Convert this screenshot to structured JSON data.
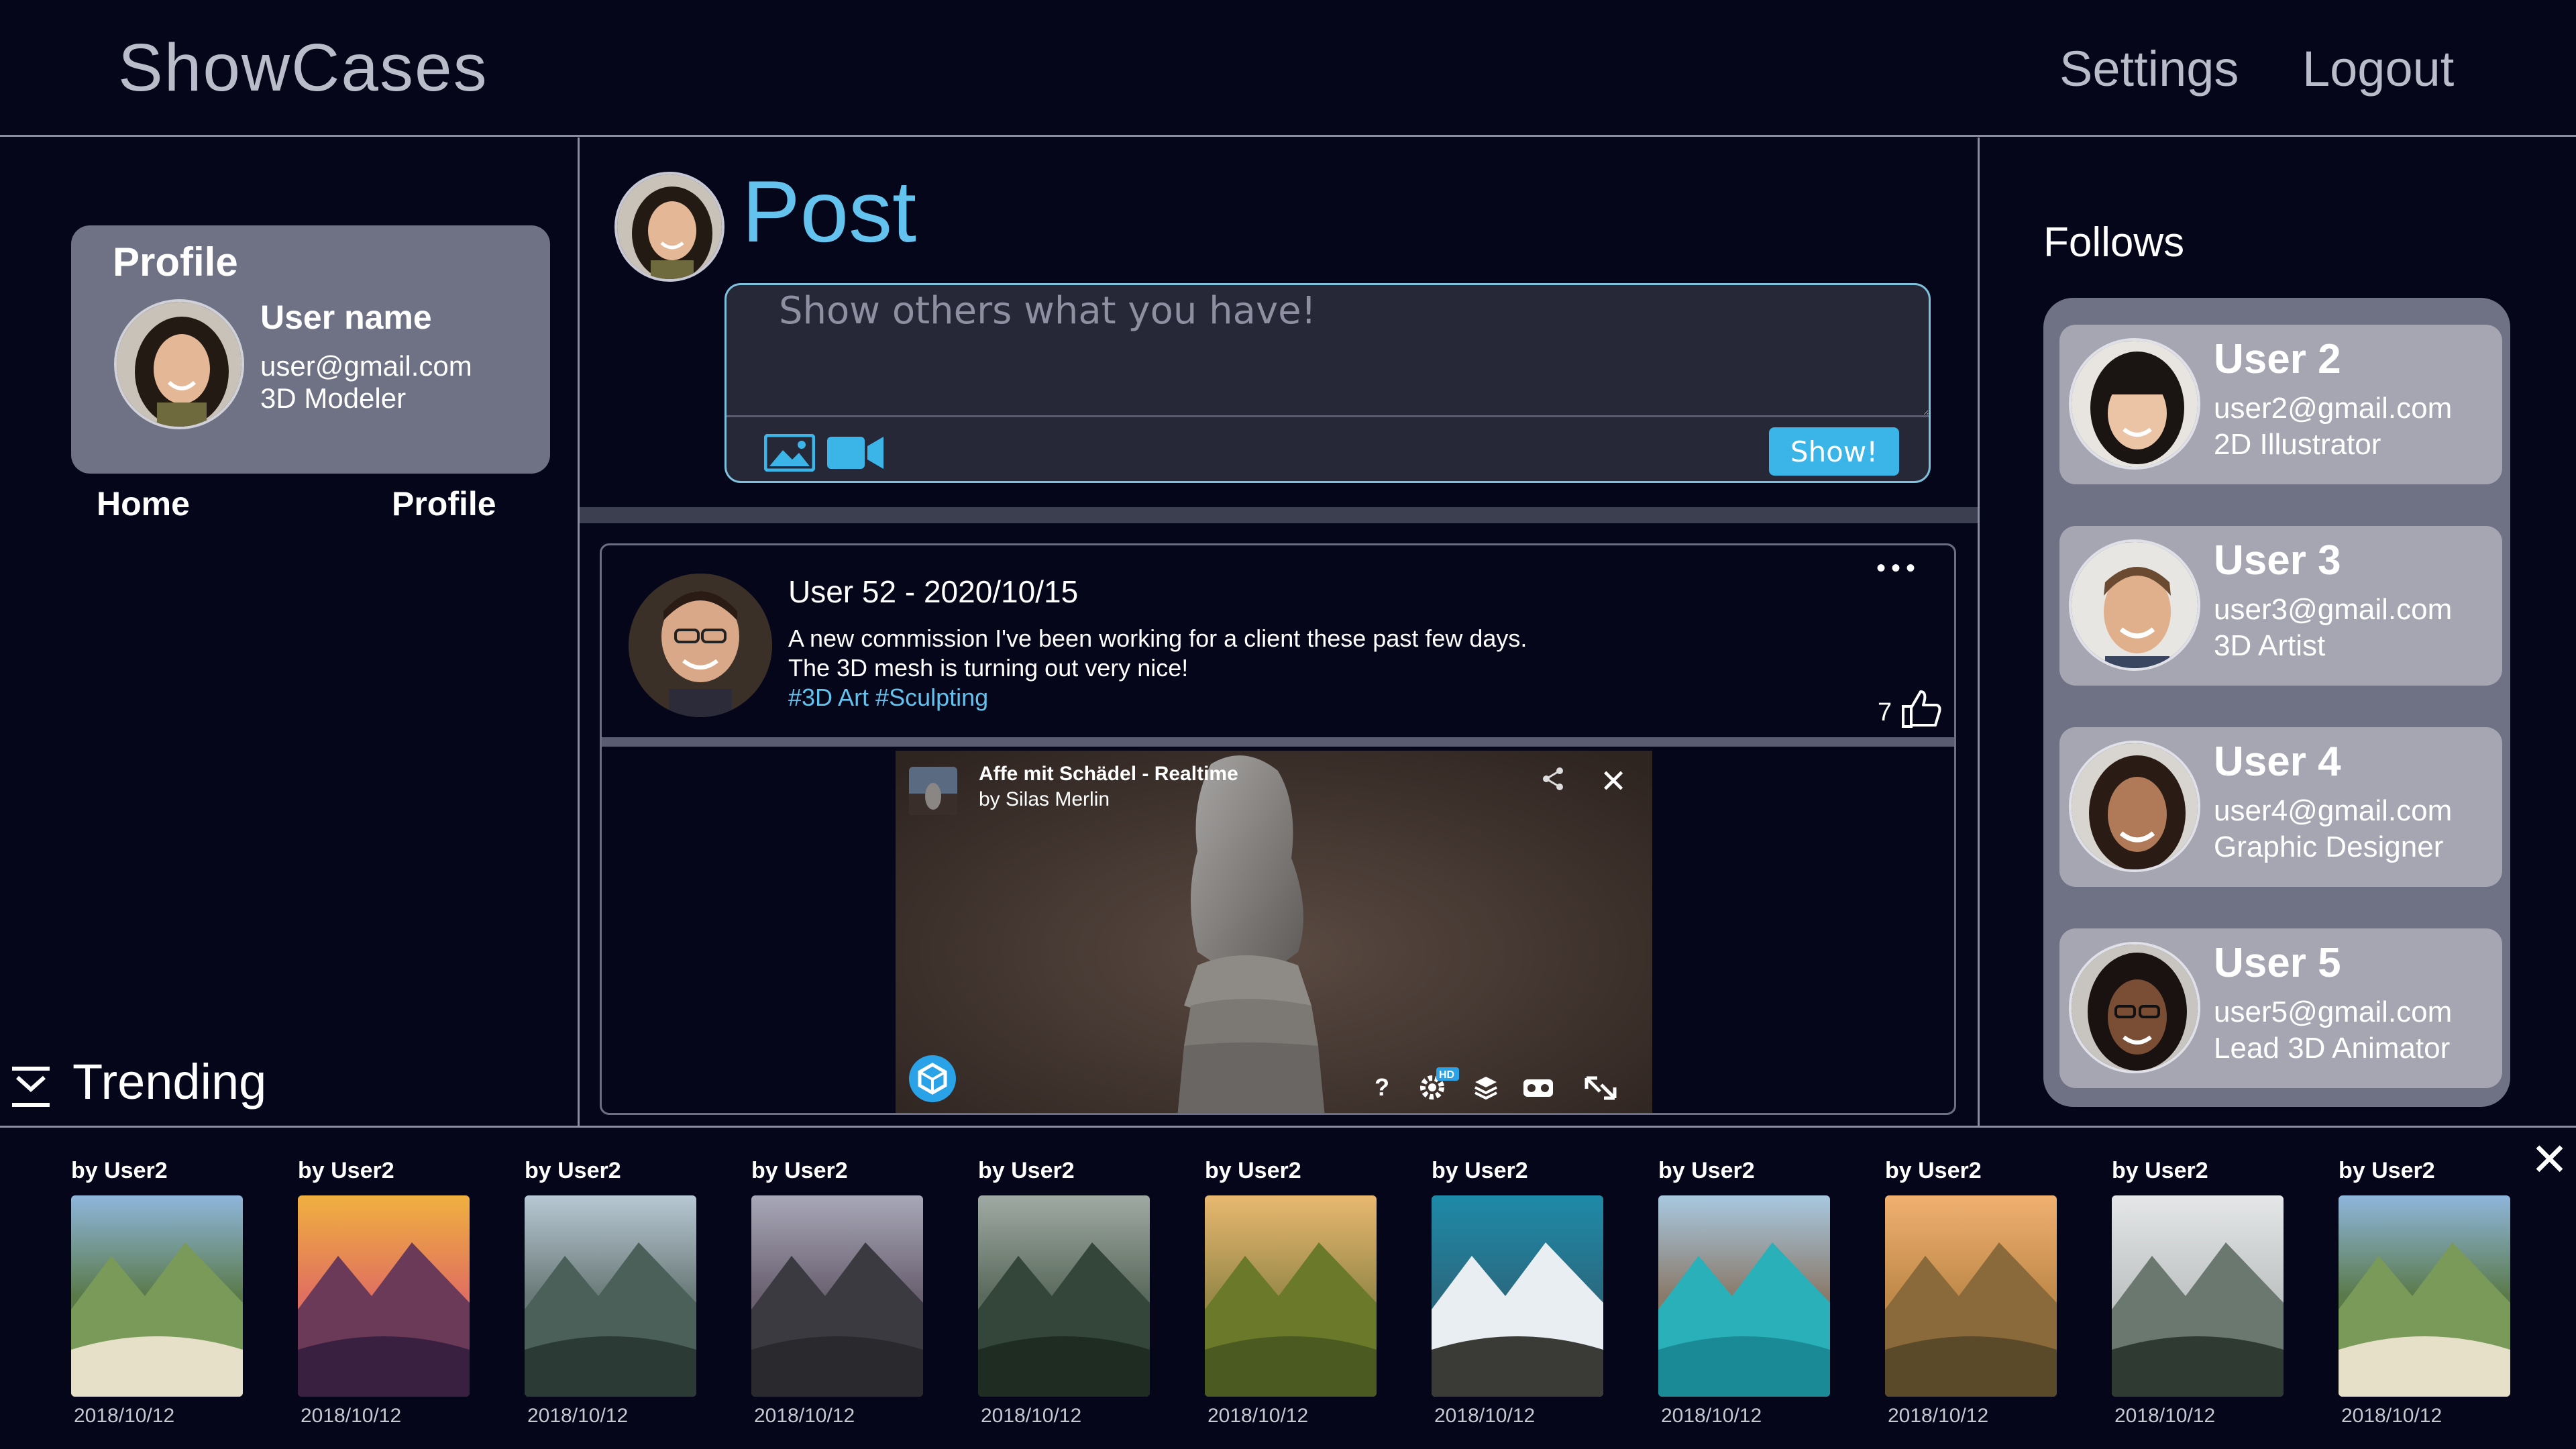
{
  "header": {
    "app_title": "ShowCases",
    "nav": {
      "settings": "Settings",
      "logout": "Logout"
    }
  },
  "profile": {
    "heading": "Profile",
    "name": "User name",
    "email": "user@gmail.com",
    "role": "3D Modeler",
    "links": {
      "home": "Home",
      "profile": "Profile"
    }
  },
  "composer": {
    "title": "Post",
    "placeholder": "Show others what you have!",
    "submit_label": "Show!"
  },
  "post": {
    "meta": "User 52 - 2020/10/15",
    "body_line1": "A new commission I've been working for a client these past few days.",
    "body_line2": "The 3D mesh is turning out very nice!",
    "tags": "#3D Art #Sculpting",
    "likes": "7",
    "more": "•••",
    "viewer": {
      "title": "Affe mit Schädel - Realtime",
      "author": "by Silas Merlin",
      "close": "✕"
    }
  },
  "follows": {
    "title": "Follows",
    "users": [
      {
        "name": "User 2",
        "email": "user2@gmail.com",
        "role": "2D Illustrator"
      },
      {
        "name": "User 3",
        "email": "user3@gmail.com",
        "role": "3D Artist"
      },
      {
        "name": "User 4",
        "email": "user4@gmail.com",
        "role": "Graphic Designer"
      },
      {
        "name": "User 5",
        "email": "user5@gmail.com",
        "role": "Lead 3D Animator"
      }
    ]
  },
  "trending": {
    "label": "Trending",
    "close": "✕",
    "items": [
      {
        "author": "by User2",
        "date": "2018/10/12",
        "scene": "meadow-hiker"
      },
      {
        "author": "by User2",
        "date": "2018/10/12",
        "scene": "sunset-mountains"
      },
      {
        "author": "by User2",
        "date": "2018/10/12",
        "scene": "lake-cabin"
      },
      {
        "author": "by User2",
        "date": "2018/10/12",
        "scene": "road-horizon"
      },
      {
        "author": "by User2",
        "date": "2018/10/12",
        "scene": "misty-forest"
      },
      {
        "author": "by User2",
        "date": "2018/10/12",
        "scene": "golden-field"
      },
      {
        "author": "by User2",
        "date": "2018/10/12",
        "scene": "snowy-peaks"
      },
      {
        "author": "by User2",
        "date": "2018/10/12",
        "scene": "turquoise-lake"
      },
      {
        "author": "by User2",
        "date": "2018/10/12",
        "scene": "balloon-valley"
      },
      {
        "author": "by User2",
        "date": "2018/10/12",
        "scene": "foggy-pines"
      },
      {
        "author": "by User2",
        "date": "2018/10/12",
        "scene": "meadow-hiker"
      }
    ]
  },
  "colors": {
    "background": "#05061a",
    "accent": "#64c3ee",
    "button": "#3bb4e8",
    "card": "#6f7184",
    "follow_card": "#a5a6b1"
  }
}
